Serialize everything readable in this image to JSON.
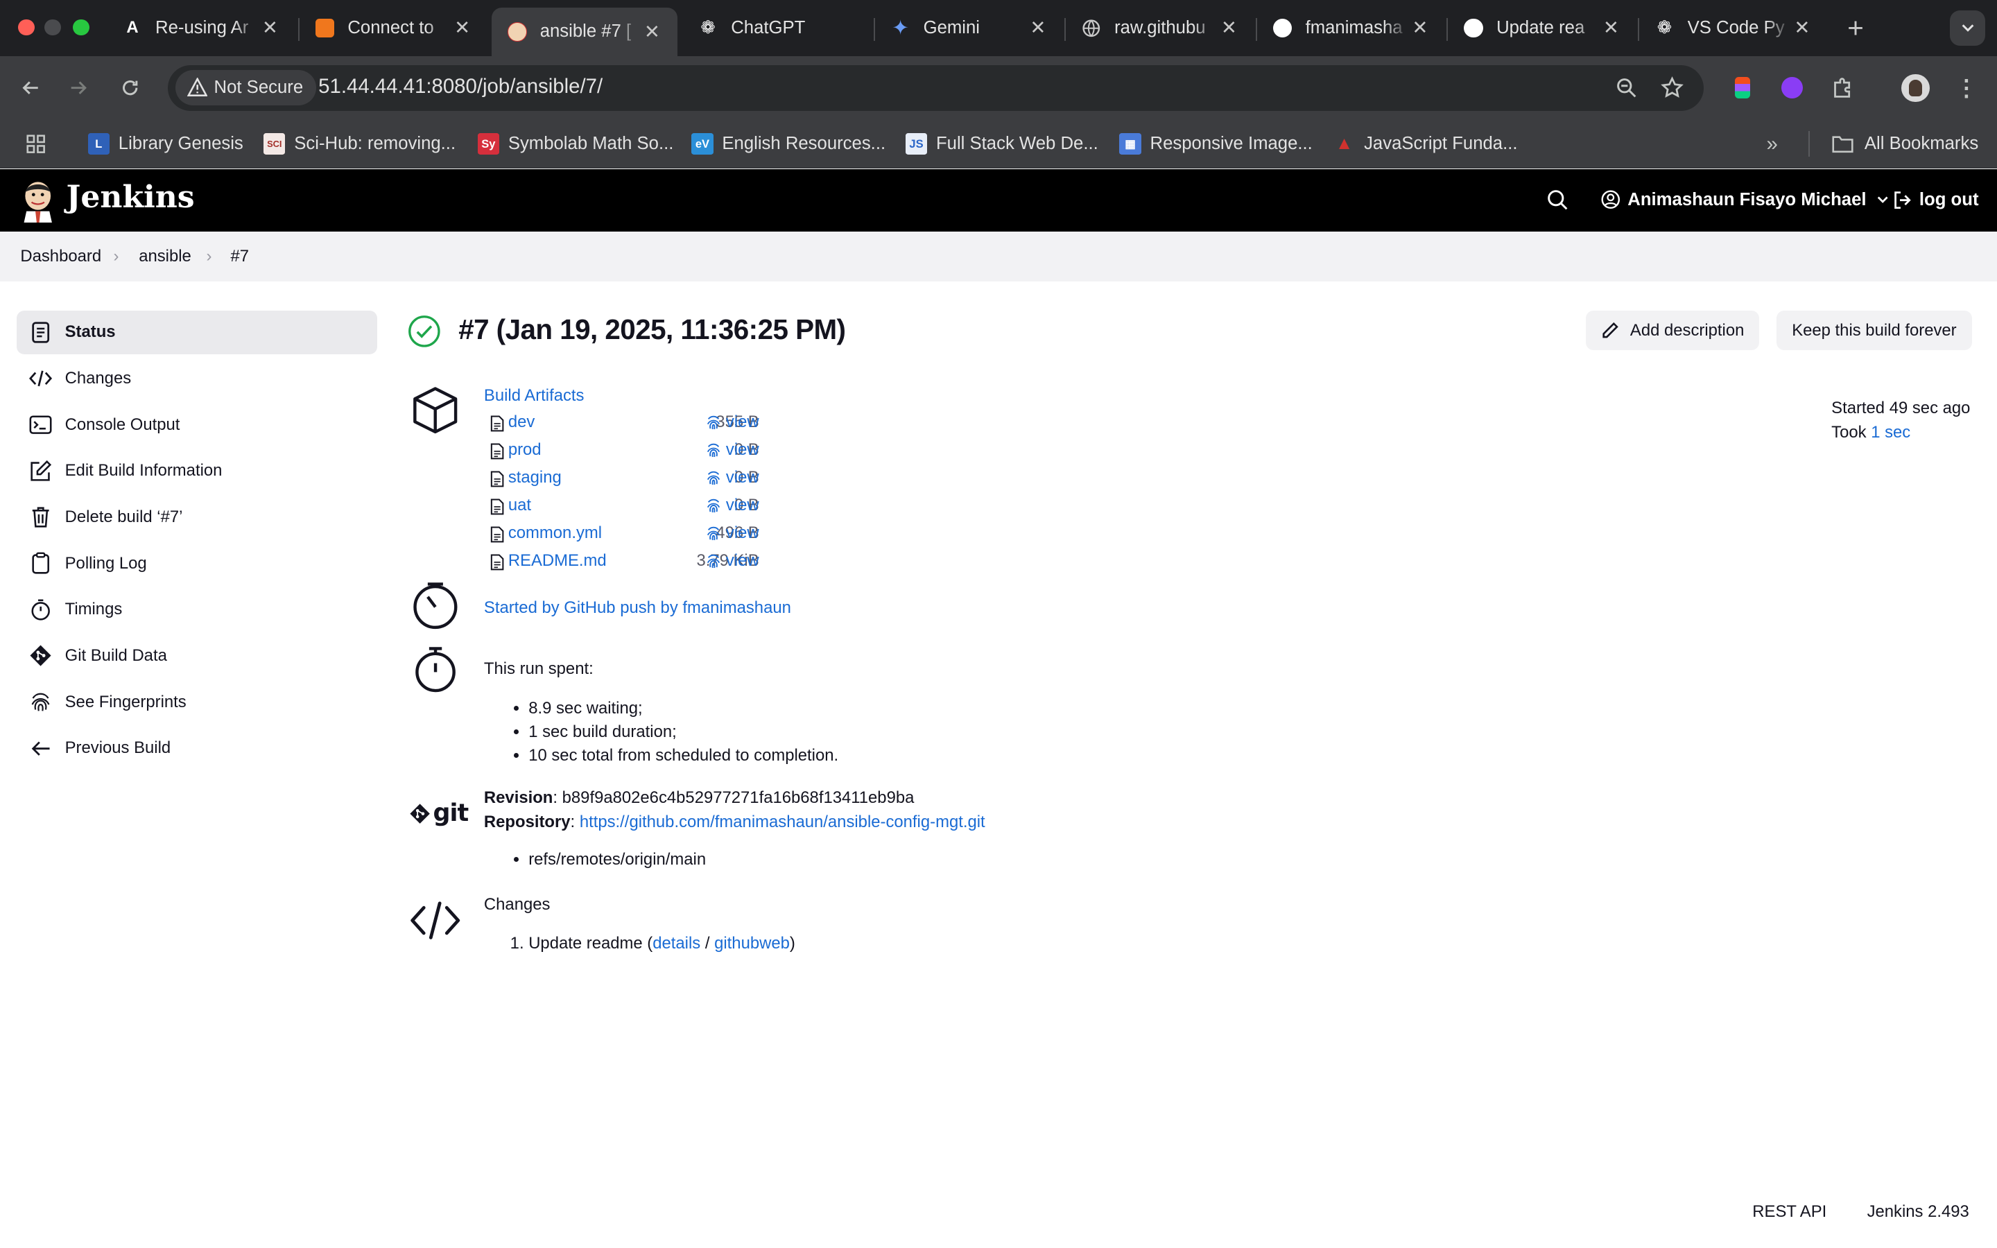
{
  "browser": {
    "tabs": [
      {
        "title": "Re-using Ar",
        "icon": "anthropic-a-icon"
      },
      {
        "title": "Connect to",
        "icon": "orange-app-icon"
      },
      {
        "title": "ansible #7 [",
        "icon": "jenkins-icon"
      },
      {
        "title": "ChatGPT",
        "icon": "openai-icon"
      },
      {
        "title": "Gemini",
        "icon": "gemini-icon"
      },
      {
        "title": "raw.githubu",
        "icon": "globe-icon"
      },
      {
        "title": "fmanimasha",
        "icon": "github-icon"
      },
      {
        "title": "Update rea",
        "icon": "github-icon"
      },
      {
        "title": "VS Code Py",
        "icon": "openai-icon"
      }
    ],
    "security_label": "Not Secure",
    "url": "51.44.44.41:8080/job/ansible/7/",
    "bookmarks": [
      {
        "label": "Library Genesis"
      },
      {
        "label": "Sci-Hub: removing..."
      },
      {
        "label": "Symbolab Math So..."
      },
      {
        "label": "English Resources..."
      },
      {
        "label": "Full Stack Web De..."
      },
      {
        "label": "Responsive Image..."
      },
      {
        "label": "JavaScript Funda..."
      }
    ],
    "all_bookmarks": "All Bookmarks"
  },
  "header": {
    "brand": "Jenkins",
    "user": "Animashaun Fisayo Michael",
    "logout": "log out"
  },
  "breadcrumbs": [
    "Dashboard",
    "ansible",
    "#7"
  ],
  "sidebar": [
    {
      "label": "Status",
      "icon": "status-icon",
      "active": true
    },
    {
      "label": "Changes",
      "icon": "code-icon"
    },
    {
      "label": "Console Output",
      "icon": "terminal-icon"
    },
    {
      "label": "Edit Build Information",
      "icon": "edit-icon"
    },
    {
      "label": "Delete build ‘#7’",
      "icon": "trash-icon"
    },
    {
      "label": "Polling Log",
      "icon": "clipboard-icon"
    },
    {
      "label": "Timings",
      "icon": "stopwatch-icon"
    },
    {
      "label": "Git Build Data",
      "icon": "git-icon"
    },
    {
      "label": "See Fingerprints",
      "icon": "fingerprint-icon"
    },
    {
      "label": "Previous Build",
      "icon": "arrow-left-icon"
    }
  ],
  "build": {
    "title": "#7 (Jan 19, 2025, 11:36:25 PM)",
    "add_description": "Add description",
    "keep_forever": "Keep this build forever",
    "started": "Started 49 sec ago",
    "took_prefix": "Took",
    "took_value": "1 sec",
    "artifacts_heading": "Build Artifacts",
    "artifacts": [
      {
        "name": "dev",
        "size": "355 B",
        "view": "view"
      },
      {
        "name": "prod",
        "size": "0 B",
        "view": "view"
      },
      {
        "name": "staging",
        "size": "0 B",
        "view": "view"
      },
      {
        "name": "uat",
        "size": "0 B",
        "view": "view"
      },
      {
        "name": "common.yml",
        "size": "496 B",
        "view": "view"
      },
      {
        "name": "README.md",
        "size": "3.79 KiB",
        "view": "view"
      }
    ],
    "cause": "Started by GitHub push by fmanimashaun",
    "run_spent_label": "This run spent:",
    "run_spent": [
      "8.9 sec waiting;",
      "1 sec build duration;",
      "10 sec total from scheduled to completion."
    ],
    "revision_label": "Revision",
    "revision": ": b89f9a802e6c4b52977271fa16b68f13411eb9ba",
    "repository_label": "Repository",
    "repository_sep": ":",
    "repository": "https://github.com/fmanimashaun/ansible-config-mgt.git",
    "refs": [
      "refs/remotes/origin/main"
    ],
    "git_logo_text": "git",
    "changes_label": "Changes",
    "changes": [
      {
        "msg": "Update readme (",
        "details": "details",
        "sep": " / ",
        "githubweb": "githubweb",
        "end": ")"
      }
    ]
  },
  "footer": {
    "rest_api": "REST API",
    "version": "Jenkins 2.493"
  }
}
